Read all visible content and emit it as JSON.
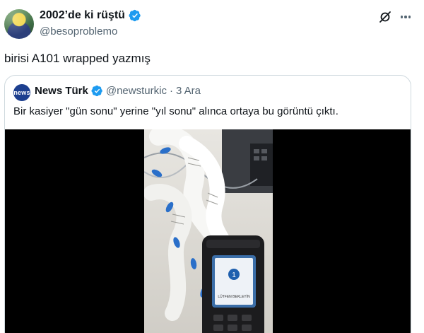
{
  "author": {
    "display_name": "2002’de ki rüştü",
    "handle": "@besoproblemo",
    "verified": true,
    "avatar_icon": "profile-avatar"
  },
  "header_actions": {
    "grok_icon": "grok-icon",
    "more_icon": "more-icon"
  },
  "tweet": {
    "text": "birisi A101 wrapped yazmış"
  },
  "quote": {
    "avatar_text": "news",
    "display_name": "News Türk",
    "handle": "@newsturkic",
    "separator": "·",
    "date": "3 Ara",
    "verified": true,
    "text": "Bir kasiyer \"gün sonu\" yerine \"yıl sonu\" alınca ortaya bu görüntü çıktı.",
    "media": {
      "type": "video",
      "terminal_screen_text": "LÜTFEN BEKLEYİN"
    }
  },
  "colors": {
    "text": "#0f1419",
    "secondary": "#536471",
    "verified_blue": "#1d9bf0",
    "border": "#cfd9de",
    "media_bg": "#000000"
  }
}
